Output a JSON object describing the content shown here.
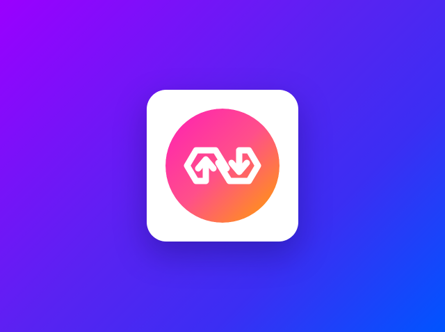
{
  "background": {
    "gradient_start": "#9a00ff",
    "gradient_mid": "#4b2cf4",
    "gradient_end": "#0054ff"
  },
  "app_icon": {
    "tile_color": "#ffffff",
    "logo": {
      "icon": "linked-chain-arrows-icon",
      "gradient_start": "#ff1fb4",
      "gradient_end": "#ffa000",
      "mark_color": "#ffffff"
    }
  }
}
